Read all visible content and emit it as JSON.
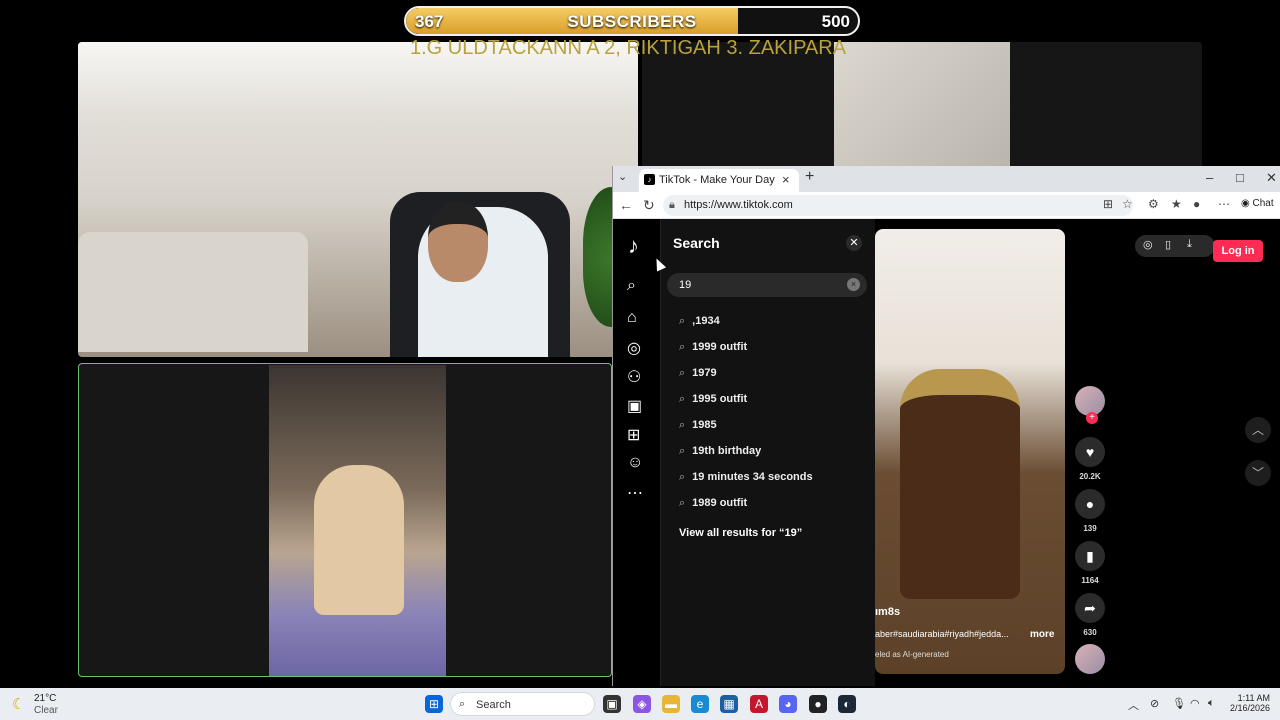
{
  "overlay": {
    "sub_current": "367",
    "sub_label": "SUBSCRIBERS",
    "sub_goal": "500",
    "progress": 0.734,
    "ticker": "1.G ULDTACKANN A 2, RIKTIGAH 3. ZAKIPARA",
    "accent_color": "#e5b33f"
  },
  "browser": {
    "tab_title": "TikTok - Make Your Day",
    "url": "https://www.tiktok.com",
    "chat_label": "Chat"
  },
  "tiktok": {
    "search_title": "Search",
    "search_value": "19",
    "suggestions": [
      ",1934",
      "1999 outfit",
      "1979",
      "1995 outfit",
      "1985",
      "19th birthday",
      "19 minutes 34 seconds",
      "1989 outfit"
    ],
    "view_all": "View all results for “19”",
    "login": "Log in",
    "caption_user": "ım8s",
    "caption_tags": "aber#saudiarabia#riyadh#jedda...",
    "caption_more": "more",
    "caption_ai": "eled as AI-generated",
    "likes": "20.2K",
    "comments": "139",
    "bookmarks": "1164",
    "shares": "630",
    "brand_color": "#fe2c55"
  },
  "taskbar": {
    "temp": "21°C",
    "condition": "Clear",
    "search_label": "Search",
    "time": "1:11 AM",
    "date": "2/16/2026"
  }
}
